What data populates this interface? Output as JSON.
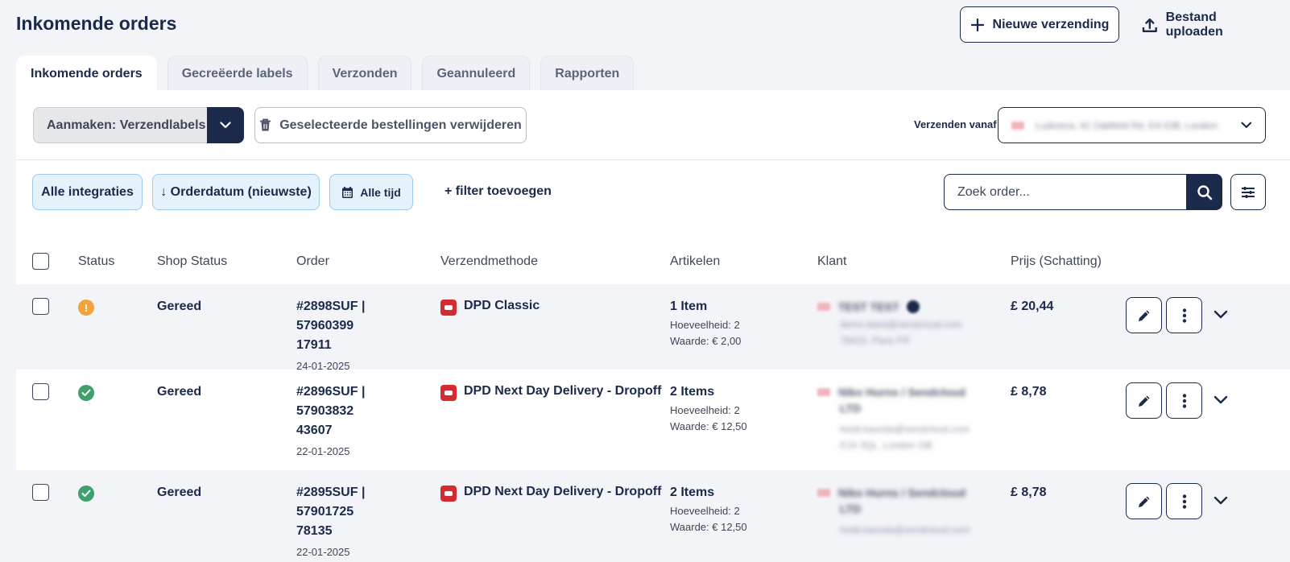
{
  "header": {
    "title": "Inkomende orders",
    "new_shipment_label": "Nieuwe verzending",
    "upload_label": "Bestand uploaden"
  },
  "tabs": [
    {
      "label": "Inkomende orders",
      "active": true
    },
    {
      "label": "Gecreëerde labels",
      "active": false
    },
    {
      "label": "Verzonden",
      "active": false
    },
    {
      "label": "Geannuleerd",
      "active": false
    },
    {
      "label": "Rapporten",
      "active": false
    }
  ],
  "toolbar": {
    "create_label": "Aanmaken: Verzendlabels",
    "delete_label": "Geselecteerde bestellingen verwijderen",
    "ship_from_label": "Verzenden vanaf",
    "ship_from_value": "Ludovica, 41 Oakfield Rd, E4 0JB, London"
  },
  "filters": {
    "integrations": "Alle integraties",
    "sort": "↓ Orderdatum (nieuwste)",
    "period": "Alle tijd",
    "add_filter": "+ filter toevoegen",
    "search_placeholder": "Zoek order..."
  },
  "table": {
    "columns": [
      "Status",
      "Shop Status",
      "Order",
      "Verzendmethode",
      "Artikelen",
      "Klant",
      "Prijs (Schatting)"
    ],
    "rows": [
      {
        "status": "warning",
        "shop_status": "Gereed",
        "order_line1": "#2898SUF | 57960399",
        "order_line2": "17911",
        "date": "24-01-2025",
        "method": "DPD Classic",
        "items": "1 Item",
        "quantity": "Hoeveelheid: 2",
        "value": "Waarde: € 2,00",
        "customer_name": "TEST TEST",
        "customer_email": "demo.klant@sendcloud.com",
        "customer_address": "78415, Paris FR",
        "price": "£ 20,44"
      },
      {
        "status": "ok",
        "shop_status": "Gereed",
        "order_line1": "#2896SUF | 57903832",
        "order_line2": "43607",
        "date": "22-01-2025",
        "method": "DPD Next Day Delivery - Dropoff",
        "items": "2 Items",
        "quantity": "Hoeveelheid: 2",
        "value": "Waarde: € 12,50",
        "customer_name": "Niko Hurns / Sendcloud",
        "customer_name2": "LTD",
        "customer_email": "heidi.kaunda@sendcloud.com",
        "customer_address": "E16 3QL, London GB",
        "price": "£ 8,78"
      },
      {
        "status": "ok",
        "shop_status": "Gereed",
        "order_line1": "#2895SUF | 57901725",
        "order_line2": "78135",
        "date": "22-01-2025",
        "method": "DPD Next Day Delivery - Dropoff",
        "items": "2 Items",
        "quantity": "Hoeveelheid: 2",
        "value": "Waarde: € 12,50",
        "customer_name": "Niko Hurns / Sendcloud",
        "customer_name2": "LTD",
        "customer_email": "heidi.kaunda@sendcloud.com",
        "price": "£ 8,78"
      }
    ]
  },
  "colors": {
    "primary": "#1b2a4a",
    "chip_bg": "#e5f2fc",
    "chip_border": "#9ec9ee",
    "warning": "#f4a23c",
    "success": "#3fa06c",
    "dpd_red": "#d52b30"
  },
  "icons": {
    "new_shipment": "plus-icon",
    "upload": "upload-icon",
    "delete": "trash-icon",
    "calendar": "calendar-icon",
    "search": "search-icon",
    "settings": "sliders-icon",
    "edit": "pencil-icon",
    "more": "more-vertical-icon",
    "expand": "chevron-down-icon"
  }
}
